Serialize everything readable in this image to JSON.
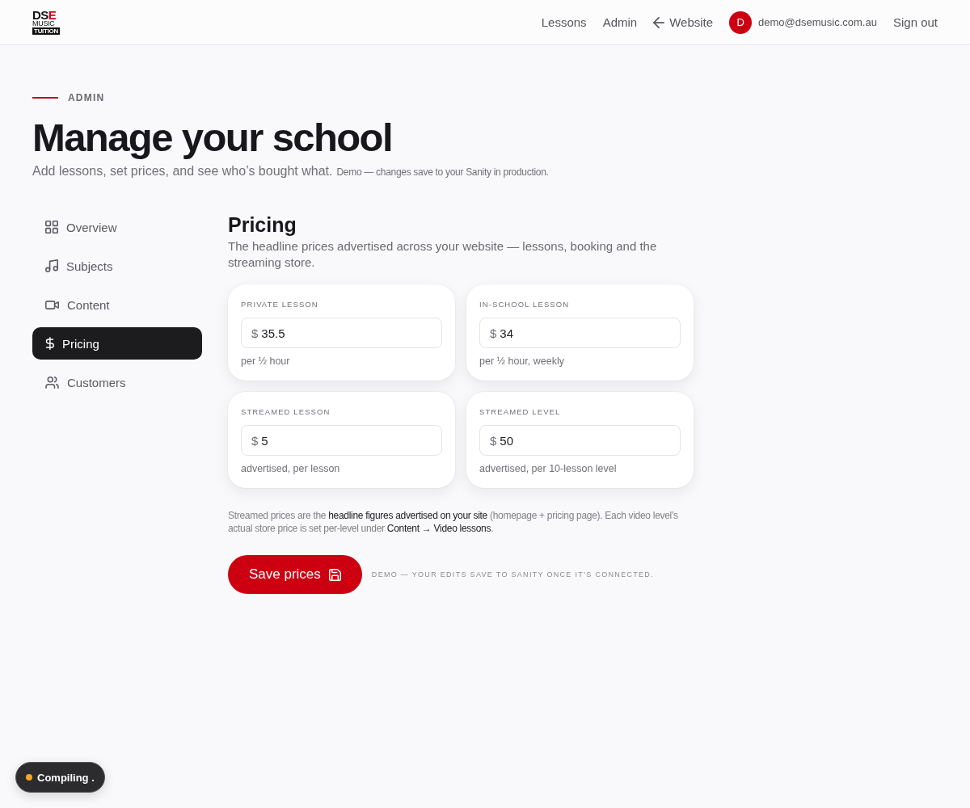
{
  "header": {
    "logo": {
      "letters": [
        {
          "text": "DS",
          "accent": false
        },
        {
          "text": "E",
          "accent": true
        }
      ],
      "line_2": "MUSIC",
      "line_3": "TUITION"
    },
    "nav": [
      {
        "label": "Lessons",
        "kind": "link"
      },
      {
        "label": "Admin",
        "kind": "link"
      },
      {
        "label": "Website",
        "kind": "back"
      }
    ],
    "user": {
      "initial": "D",
      "email": "demo@dsemusic.com.au"
    },
    "sign_out": "Sign out"
  },
  "intro": {
    "eyebrow": "ADMIN",
    "title": "Manage your school",
    "subtitle": "Add lessons, set prices, and see who’s bought what.",
    "note": "Demo — changes save to your Sanity in production."
  },
  "sidebar": {
    "items": [
      {
        "label": "Overview",
        "selected": false
      },
      {
        "label": "Subjects",
        "selected": false
      },
      {
        "label": "Content",
        "selected": false
      },
      {
        "label": "Pricing",
        "selected": true
      },
      {
        "label": "Customers",
        "selected": false
      }
    ]
  },
  "pricing": {
    "title": "Pricing",
    "description": "The headline prices advertised across your website — lessons, booking and the streaming store.",
    "cards": [
      {
        "label": "PRIVATE LESSON",
        "currency": "$",
        "value": "35.5",
        "hint": "per ½ hour"
      },
      {
        "label": "IN-SCHOOL LESSON",
        "currency": "$",
        "value": "34",
        "hint": "per ½ hour, weekly"
      },
      {
        "label": "STREAMED LESSON",
        "currency": "$",
        "value": "5",
        "hint": "advertised, per lesson"
      },
      {
        "label": "STREAMED LEVEL",
        "currency": "$",
        "value": "50",
        "hint": "advertised, per 10-lesson level"
      }
    ],
    "note": "Streamed prices are the **headline figures advertised on your site** (homepage + pricing page). Each video level’s actual store price is set per-level under **Content → Video lessons**.",
    "save_button": "Save prices",
    "save_note": "DEMO — YOUR EDITS SAVE TO SANITY ONCE IT’S CONNECTED."
  },
  "build_status": {
    "label": "Compiling ."
  }
}
